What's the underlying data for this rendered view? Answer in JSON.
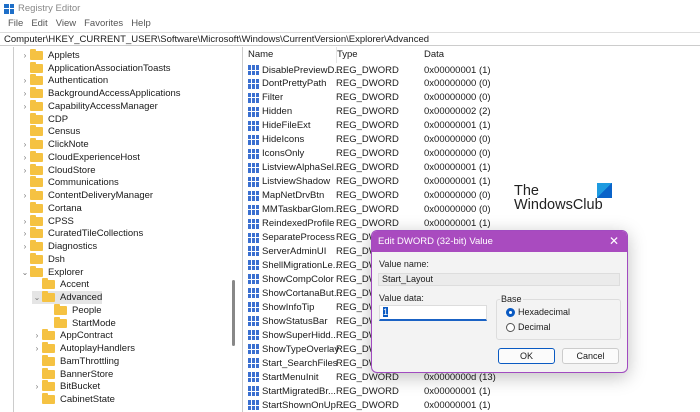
{
  "window": {
    "title": "Registry Editor"
  },
  "menu": [
    "File",
    "Edit",
    "View",
    "Favorites",
    "Help"
  ],
  "address": "Computer\\HKEY_CURRENT_USER\\Software\\Microsoft\\Windows\\CurrentVersion\\Explorer\\Advanced",
  "tree": [
    {
      "label": "Applets",
      "level": 0,
      "chevron": ">"
    },
    {
      "label": "ApplicationAssociationToasts",
      "level": 0,
      "chevron": ""
    },
    {
      "label": "Authentication",
      "level": 0,
      "chevron": ">"
    },
    {
      "label": "BackgroundAccessApplications",
      "level": 0,
      "chevron": ">"
    },
    {
      "label": "CapabilityAccessManager",
      "level": 0,
      "chevron": ">"
    },
    {
      "label": "CDP",
      "level": 0,
      "chevron": ""
    },
    {
      "label": "Census",
      "level": 0,
      "chevron": ""
    },
    {
      "label": "ClickNote",
      "level": 0,
      "chevron": ">"
    },
    {
      "label": "CloudExperienceHost",
      "level": 0,
      "chevron": ">"
    },
    {
      "label": "CloudStore",
      "level": 0,
      "chevron": ">"
    },
    {
      "label": "Communications",
      "level": 0,
      "chevron": ""
    },
    {
      "label": "ContentDeliveryManager",
      "level": 0,
      "chevron": ">"
    },
    {
      "label": "Cortana",
      "level": 0,
      "chevron": ""
    },
    {
      "label": "CPSS",
      "level": 0,
      "chevron": ">"
    },
    {
      "label": "CuratedTileCollections",
      "level": 0,
      "chevron": ">"
    },
    {
      "label": "Diagnostics",
      "level": 0,
      "chevron": ">"
    },
    {
      "label": "Dsh",
      "level": 0,
      "chevron": ""
    },
    {
      "label": "Explorer",
      "level": 0,
      "chevron": "v"
    },
    {
      "label": "Accent",
      "level": 1,
      "chevron": ""
    },
    {
      "label": "Advanced",
      "level": 1,
      "chevron": "v",
      "selected": true
    },
    {
      "label": "People",
      "level": 2,
      "chevron": ""
    },
    {
      "label": "StartMode",
      "level": 2,
      "chevron": ""
    },
    {
      "label": "AppContract",
      "level": 1,
      "chevron": ">"
    },
    {
      "label": "AutoplayHandlers",
      "level": 1,
      "chevron": ">"
    },
    {
      "label": "BamThrottling",
      "level": 1,
      "chevron": ""
    },
    {
      "label": "BannerStore",
      "level": 1,
      "chevron": ""
    },
    {
      "label": "BitBucket",
      "level": 1,
      "chevron": ">"
    },
    {
      "label": "CabinetState",
      "level": 1,
      "chevron": ""
    }
  ],
  "list": {
    "headers": {
      "name": "Name",
      "type": "Type",
      "data": "Data"
    },
    "rows": [
      {
        "name": "DisablePreviewD...",
        "type": "REG_DWORD",
        "data": "0x00000001 (1)"
      },
      {
        "name": "DontPrettyPath",
        "type": "REG_DWORD",
        "data": "0x00000000 (0)"
      },
      {
        "name": "Filter",
        "type": "REG_DWORD",
        "data": "0x00000000 (0)"
      },
      {
        "name": "Hidden",
        "type": "REG_DWORD",
        "data": "0x00000002 (2)"
      },
      {
        "name": "HideFileExt",
        "type": "REG_DWORD",
        "data": "0x00000001 (1)"
      },
      {
        "name": "HideIcons",
        "type": "REG_DWORD",
        "data": "0x00000000 (0)"
      },
      {
        "name": "IconsOnly",
        "type": "REG_DWORD",
        "data": "0x00000000 (0)"
      },
      {
        "name": "ListviewAlphaSel...",
        "type": "REG_DWORD",
        "data": "0x00000001 (1)"
      },
      {
        "name": "ListviewShadow",
        "type": "REG_DWORD",
        "data": "0x00000001 (1)"
      },
      {
        "name": "MapNetDrvBtn",
        "type": "REG_DWORD",
        "data": "0x00000000 (0)"
      },
      {
        "name": "MMTaskbarGlom...",
        "type": "REG_DWORD",
        "data": "0x00000000 (0)"
      },
      {
        "name": "ReindexedProfile",
        "type": "REG_DWORD",
        "data": "0x00000001 (1)"
      },
      {
        "name": "SeparateProcess",
        "type": "REG_DWORD",
        "data": ""
      },
      {
        "name": "ServerAdminUI",
        "type": "REG_DWORD",
        "data": ""
      },
      {
        "name": "ShellMigrationLe...",
        "type": "REG_DWORD",
        "data": ""
      },
      {
        "name": "ShowCompColor",
        "type": "REG_DWORD",
        "data": ""
      },
      {
        "name": "ShowCortanaBut...",
        "type": "REG_DWORD",
        "data": ""
      },
      {
        "name": "ShowInfoTip",
        "type": "REG_DWORD",
        "data": ""
      },
      {
        "name": "ShowStatusBar",
        "type": "REG_DWORD",
        "data": ""
      },
      {
        "name": "ShowSuperHidd...",
        "type": "REG_DWORD",
        "data": ""
      },
      {
        "name": "ShowTypeOverlay",
        "type": "REG_DWORD",
        "data": ""
      },
      {
        "name": "Start_SearchFiles",
        "type": "REG_DWORD",
        "data": ""
      },
      {
        "name": "StartMenuInit",
        "type": "REG_DWORD",
        "data": "0x0000000d (13)"
      },
      {
        "name": "StartMigratedBr...",
        "type": "REG_DWORD",
        "data": "0x00000001 (1)"
      },
      {
        "name": "StartShownOnUp...",
        "type": "REG_DWORD",
        "data": "0x00000001 (1)"
      }
    ]
  },
  "watermark": {
    "line1": "The",
    "line2": "WindowsClub"
  },
  "dialog": {
    "title": "Edit DWORD (32-bit) Value",
    "value_name_label": "Value name:",
    "value_name": "Start_Layout",
    "value_data_label": "Value data:",
    "value_data": "1",
    "base_label": "Base",
    "hex_label": "Hexadecimal",
    "dec_label": "Decimal",
    "selected_base": "Hexadecimal",
    "ok": "OK",
    "cancel": "Cancel"
  },
  "colors": {
    "dialog_title": "#a94bbf",
    "accent": "#0a5ac2",
    "folder": "#f5c242"
  }
}
